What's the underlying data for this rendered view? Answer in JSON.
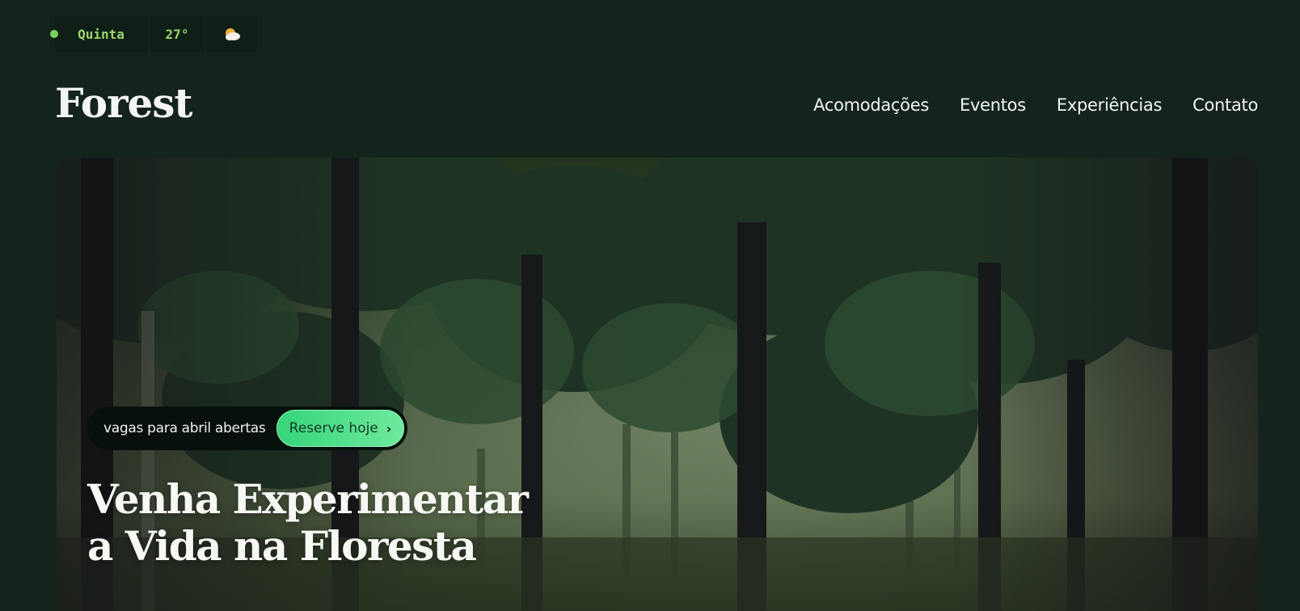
{
  "status": {
    "day": "Quinta",
    "temperature": "27°",
    "weather_icon": "partly-cloudy-icon",
    "accent": "#9bd66a"
  },
  "header": {
    "logo": "Forest",
    "nav": [
      "Acomodações",
      "Eventos",
      "Experiências",
      "Contato"
    ]
  },
  "hero": {
    "promo_text": "vagas para abril abertas",
    "cta_label": "Reserve hoje",
    "cta_color": "#36d57c",
    "title_line1": "Venha Experimentar",
    "title_line2": "a Vida na Floresta",
    "image": "forest-photo"
  }
}
